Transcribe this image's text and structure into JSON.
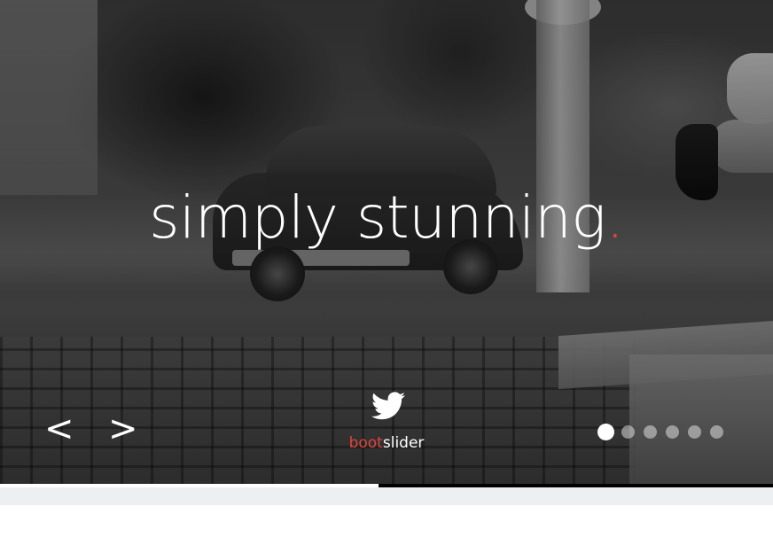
{
  "slider": {
    "headline": "simply stunning",
    "headline_punct": ".",
    "nav": {
      "prev_label": "<",
      "next_label": ">"
    },
    "social_icon": "twitter-icon",
    "brand": {
      "accent_part": "boot",
      "plain_part": "slider"
    },
    "pagination": {
      "total": 6,
      "active_index": 0
    },
    "progress": 0.49
  },
  "colors": {
    "accent": "#e0443a",
    "text": "#ffffff",
    "progress_track": "#000000",
    "progress_fill": "#ffffff",
    "footer_bar": "#edeff0"
  }
}
